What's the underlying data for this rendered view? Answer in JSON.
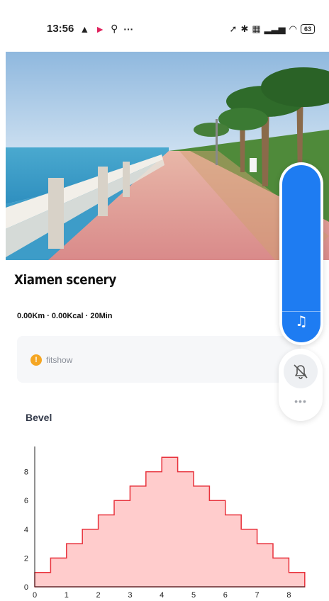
{
  "status_bar": {
    "time": "13:56",
    "battery": "63",
    "icons": [
      "warning-icon",
      "flag-icon",
      "search-person-icon",
      "more-icon",
      "location-icon",
      "bluetooth-icon",
      "sim-icon",
      "signal-icon",
      "wifi-icon",
      "battery-icon"
    ]
  },
  "hero": {
    "image": "seaside-promenade-photo"
  },
  "course": {
    "title": "Xiamen scenery",
    "stats": "0.00Km · 0.00Kcal · 20Min"
  },
  "notice": {
    "icon": "warning-icon",
    "text": "fitshow"
  },
  "section": {
    "title": "Bevel"
  },
  "float_controls": {
    "music_icon": "music-note-icon",
    "bell_icon": "bell-off-icon",
    "more_icon": "more-dots-icon",
    "accent": "#1e7cf2"
  },
  "chart_data": {
    "type": "area",
    "step": true,
    "x_ticks": [
      "0",
      "1",
      "2",
      "3",
      "4",
      "5",
      "6",
      "7",
      "8"
    ],
    "y_ticks": [
      "0",
      "2",
      "4",
      "6",
      "8"
    ],
    "xlim": [
      0,
      8.5
    ],
    "ylim": [
      0,
      10
    ],
    "values": [
      1,
      2,
      3,
      4,
      5,
      6,
      7,
      8,
      9,
      8,
      7,
      6,
      5,
      4,
      3,
      2,
      1
    ],
    "segment_width": 0.5,
    "fill_color": "#ffcccc",
    "line_color": "#e8323c",
    "grid": false
  }
}
